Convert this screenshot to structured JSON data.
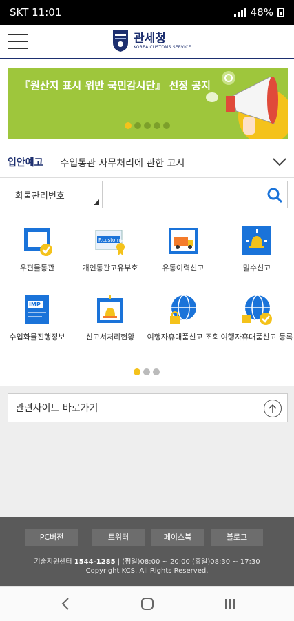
{
  "status_bar": {
    "carrier_time": "SKT 11:01",
    "battery": "48%"
  },
  "header": {
    "logo_title": "관세청",
    "logo_subtitle": "KOREA CUSTOMS SERVICE"
  },
  "banner": {
    "text": "『원산지 표시 위반 국민감시단』 선정 공지"
  },
  "notice": {
    "category": "입안예고",
    "message": "수입통관 사무처리에 관한 고시"
  },
  "search": {
    "select_value": "화물관리번호",
    "input_value": ""
  },
  "services": [
    {
      "label": "우편물통관",
      "icon": "mail-check-icon"
    },
    {
      "label": "개인통관고유부호",
      "icon": "p-customs-card-icon"
    },
    {
      "label": "유통이력신고",
      "icon": "delivery-truck-icon"
    },
    {
      "label": "밀수신고",
      "icon": "alarm-bell-icon"
    },
    {
      "label": "수입화물진행정보",
      "icon": "imp-document-icon"
    },
    {
      "label": "신고서처리현황",
      "icon": "report-status-icon"
    },
    {
      "label": "여행자휴대품신고 조회",
      "icon": "globe-lock-icon"
    },
    {
      "label": "여행자휴대품신고 등록",
      "icon": "globe-check-icon"
    }
  ],
  "related_sites": {
    "label": "관련사이트 바로가기"
  },
  "footer": {
    "links": [
      "PC버전",
      "트위터",
      "페이스북",
      "블로그"
    ],
    "support_label": "기술지원센터",
    "support_number": "1544-1285",
    "support_hours": "| (평일)08:00 ~ 20:00 (휴일)08:30 ~ 17:30",
    "copyright": "Copyright KCS. All Rights Reserved."
  },
  "colors": {
    "navy": "#1d2f6f",
    "banner_green": "#9ec63c",
    "accent_yellow": "#f4c21b",
    "icon_blue": "#1a73d9"
  }
}
